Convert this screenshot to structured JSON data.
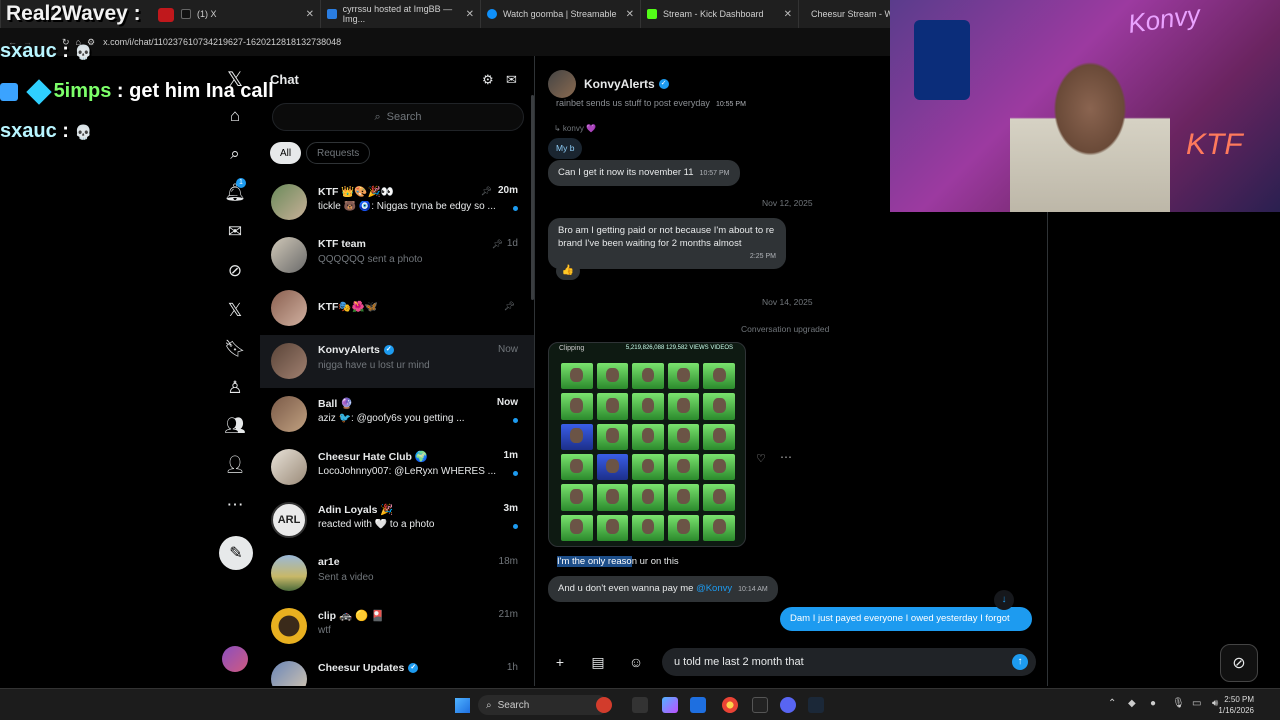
{
  "browser": {
    "tabs": [
      {
        "label": "(1) X",
        "color": "#e7e9ea"
      },
      {
        "label": "cyrrssu hosted at ImgBB — Img...",
        "color": "#2a7de1"
      },
      {
        "label": "Watch goomba | Streamable",
        "color": "#0f90fa"
      },
      {
        "label": "Stream - Kick Dashboard",
        "color": "#53fc18"
      },
      {
        "label": "Cheesur Stream - W",
        "color": "#53fc18"
      }
    ],
    "url": "x.com/i/chat/1102376107342196​27-1620212818132738048"
  },
  "overlay": {
    "streamer": "Real2Wavey :",
    "chat": [
      {
        "user": "sxauc",
        "sep": " : ",
        "msg": "💀",
        "color": "#b8f5ff"
      },
      {
        "user": "5imps",
        "sep": " : ",
        "msg": "get him Ina call",
        "color": "#7dff6a"
      },
      {
        "user": "sxauc",
        "sep": " : ",
        "msg": "💀",
        "color": "#b8f5ff"
      }
    ]
  },
  "nav": {
    "notifications_badge": "1"
  },
  "chat_list": {
    "title": "Chat",
    "search_placeholder": "Search",
    "filters": [
      "All",
      "Requests"
    ],
    "items": [
      {
        "name": "KTF 👑🎨🎉👀",
        "preview": "tickle 🐻 🧿: Niggas tryna be edgy so ...",
        "time": "20m",
        "pinned": true,
        "unread": true,
        "avatar": "#6a8a5a"
      },
      {
        "name": "KTF team",
        "preview": "QQQQQQ sent a photo",
        "time": "1d",
        "pinned": true,
        "unread": false,
        "avatar": "#d0c8b8"
      },
      {
        "name": "KTF🎭🌺🦋",
        "preview": "",
        "time": "",
        "pinned": true,
        "unread": false,
        "avatar": "#8a6050"
      },
      {
        "name": "KonvyAlerts",
        "preview": "nigga have u lost ur mind",
        "time": "Now",
        "pinned": false,
        "unread": false,
        "avatar": "#5a4438",
        "verified": true
      },
      {
        "name": "Ball 🔮",
        "preview": "aziz 🐦: @goofy6s you getting ...",
        "time": "Now",
        "pinned": false,
        "unread": true,
        "avatar": "#7a5a48"
      },
      {
        "name": "Cheesur Hate Club 🌍",
        "preview": "LocoJohnny007: @LeRyxn WHERES ...",
        "time": "1m",
        "pinned": false,
        "unread": true,
        "avatar": "#e8e2d8"
      },
      {
        "name": "Adin Loyals 🎉",
        "preview": "reacted with 🤍 to a photo",
        "time": "3m",
        "pinned": false,
        "unread": true,
        "avatar": "#eaeaea",
        "initials": "ARL"
      },
      {
        "name": "ar1e",
        "preview": "Sent a video",
        "time": "18m",
        "pinned": false,
        "unread": false,
        "avatar": "#c8b868"
      },
      {
        "name": "clip 🚓 🟡 🎴",
        "preview": "wtf",
        "time": "21m",
        "pinned": false,
        "unread": false,
        "avatar": "#e8b020"
      },
      {
        "name": "Cheesur Updates",
        "preview": "",
        "time": "1h",
        "pinned": false,
        "unread": false,
        "avatar": "#6a86b8",
        "verified": true
      }
    ]
  },
  "conversation": {
    "name": "KonvyAlerts",
    "messages": {
      "m1": "rainbet sends us stuff to post everyday",
      "m1_time": "10:55 PM",
      "reply_to": "↳ konvy 💜",
      "reply_text": "My b",
      "m2": "Can I get it now its november 11",
      "m2_time": "10:57 PM",
      "date1": "Nov 12, 2025",
      "m3": "Bro am I getting paid or not because I'm about to re brand I've been waiting for 2 months almost",
      "m3_time": "2:25 PM",
      "m3_reaction": "👍",
      "date2": "Nov 14, 2025",
      "system": "Conversation upgraded",
      "photo_label": "Clipping",
      "photo_stats": "5,219,826,088  129,582  VIEWS  VIDEOS",
      "m4_highlight": "I'm the only reaso",
      "m4_rest": "n ur on this",
      "m5": "And u don't even wanna pay me",
      "m5_mention": "@Konvy",
      "m5_time": "10:14 AM",
      "out1": "Dam I just payed everyone I owed yesterday I forgot"
    },
    "composer_text": "u told me last 2 month that"
  },
  "webcam": {
    "sign": "Konvy",
    "tag": "KTF"
  },
  "taskbar": {
    "search": "Search",
    "time": "2:50 PM",
    "date": "1/16/2026"
  },
  "colors": {
    "accent": "#1d9bf0",
    "bg": "#000000",
    "bubble_in": "#2f3336"
  }
}
